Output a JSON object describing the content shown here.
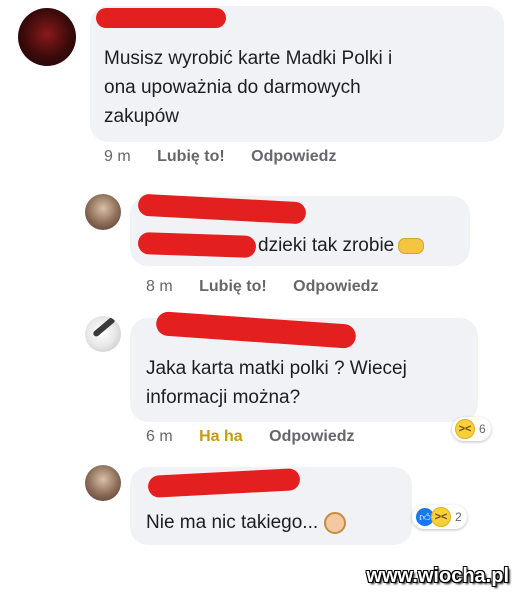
{
  "comments": [
    {
      "text_lines": [
        "Musisz wyrobić karte Madki Polki i",
        "ona upoważnia do darmowych",
        "zakupów"
      ],
      "time": "9 m",
      "like_label": "Lubię to!",
      "reply_label": "Odpowiedz"
    },
    {
      "text": "dzieki tak zrobie",
      "time": "8 m",
      "like_label": "Lubię to!",
      "reply_label": "Odpowiedz"
    },
    {
      "text_lines": [
        "Jaka karta matki polki ? Wiecej",
        "informacji można?"
      ],
      "time": "6 m",
      "like_label": "Ha ha",
      "reply_label": "Odpowiedz",
      "reactions": {
        "icons": [
          "laugh-reaction-icon"
        ],
        "count": "6"
      }
    },
    {
      "text": "Nie ma nic takiego...",
      "reactions": {
        "icons": [
          "like-reaction-icon",
          "laugh-reaction-icon"
        ],
        "count": "2"
      }
    }
  ],
  "watermark": "www.wiocha.pl",
  "colors": {
    "bubble": "#f0f2f5",
    "meta": "#65676b",
    "haha": "#c99a0b",
    "redaction": "#e41f1f"
  }
}
